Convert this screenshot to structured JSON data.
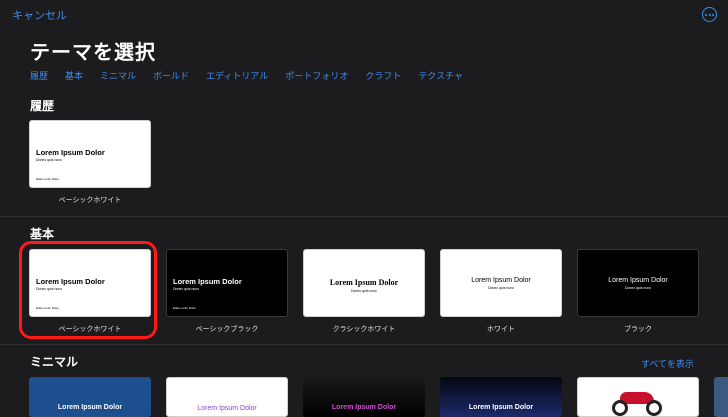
{
  "nav": {
    "cancel_label": "キャンセル",
    "more_icon": "ellipsis-circle-icon"
  },
  "page_title": "テーマを選択",
  "tabs": [
    "履歴",
    "基本",
    "ミニマル",
    "ボールド",
    "エディトリアル",
    "ポートフォリオ",
    "クラフト",
    "テクスチャ"
  ],
  "sections": {
    "recent": {
      "heading": "履歴",
      "items": [
        {
          "name": "ベーシックホワイト",
          "title": "Lorem Ipsum Dolor",
          "subtitle": "Donec quis nunc",
          "footer": "Etiam enim Dolor"
        }
      ]
    },
    "basic": {
      "heading": "基本",
      "items": [
        {
          "name": "ベーシックホワイト",
          "title": "Lorem Ipsum Dolor",
          "subtitle": "Donec quis nunc",
          "footer": "Etiam enim Dolor"
        },
        {
          "name": "ベーシックブラック",
          "title": "Lorem Ipsum Dolor",
          "subtitle": "Donec quis nunc",
          "footer": "Etiam enim Dolor"
        },
        {
          "name": "クラシックホワイト",
          "title": "Lorem Ipsum Dolor",
          "subtitle": "Donec quis nunc"
        },
        {
          "name": "ホワイト",
          "title": "Lorem Ipsum Dolor",
          "subtitle": "Donec quis nunc"
        },
        {
          "name": "ブラック",
          "title": "Lorem Ipsum Dolor",
          "subtitle": "Donec quis nunc"
        }
      ]
    },
    "minimal": {
      "heading": "ミニマル",
      "see_all": "すべてを表示",
      "items": [
        {
          "title": "Lorem Ipsum Dolor"
        },
        {
          "title": "Lorem Ipsum Dolor"
        },
        {
          "title": "Lorem Ipsum Dolor"
        },
        {
          "title": "Lorem Ipsum Dolor"
        }
      ]
    }
  },
  "colors": {
    "accent": "#3d8cf5",
    "background": "#1c1c1e",
    "highlight": "#ff1a1a"
  }
}
